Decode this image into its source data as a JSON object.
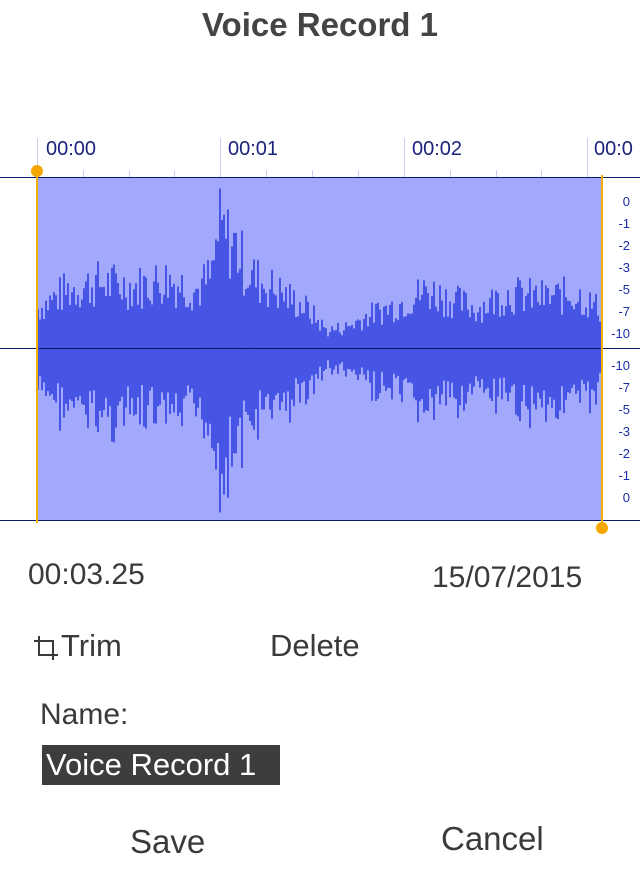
{
  "header": {
    "title": "Voice Record 1"
  },
  "timeline": {
    "ticks": [
      "00:00",
      "00:01",
      "00:02",
      "00:0"
    ]
  },
  "db_scale": {
    "top": [
      "0",
      "-1",
      "-2",
      "-3",
      "-5",
      "-7",
      "-10"
    ],
    "bottom": [
      "-10",
      "-7",
      "-5",
      "-3",
      "-2",
      "-1",
      "0"
    ]
  },
  "waveform": {
    "color": "#1428d6",
    "background": "#a2a8fb",
    "duration_seconds": 3.25
  },
  "info": {
    "duration": "00:03.25",
    "date": "15/07/2015"
  },
  "actions": {
    "trim_label": "Trim",
    "delete_label": "Delete"
  },
  "name": {
    "label": "Name:",
    "value": "Voice Record 1"
  },
  "buttons": {
    "save_label": "Save",
    "cancel_label": "Cancel"
  },
  "colors": {
    "accent": "#f6a800",
    "axis": "#0a1a6b"
  }
}
